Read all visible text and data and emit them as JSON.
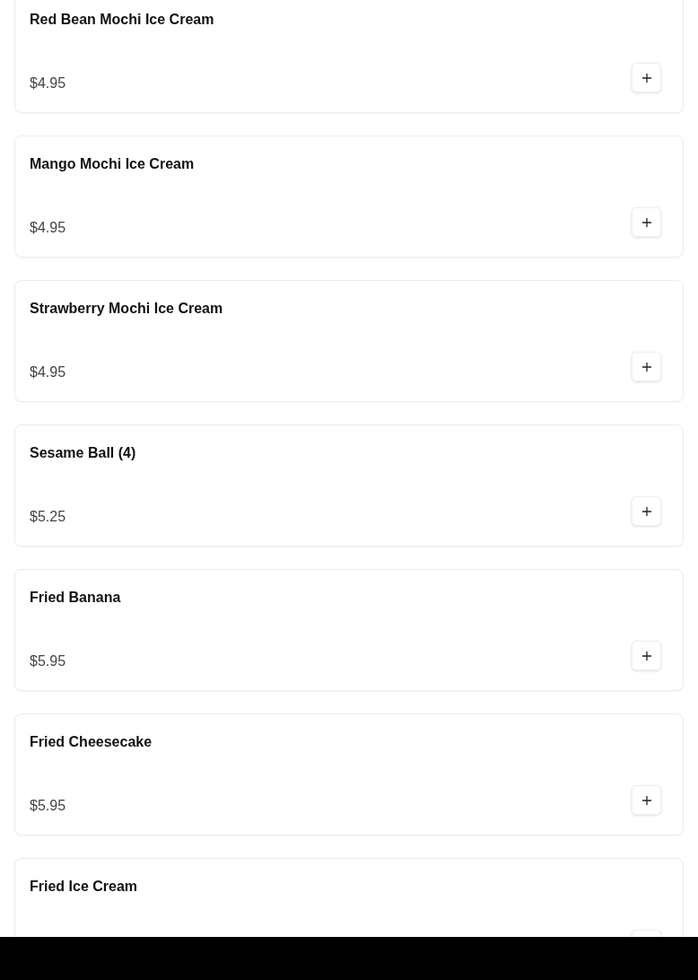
{
  "menu_items": [
    {
      "name": "Red Bean Mochi Ice Cream",
      "price": "$4.95"
    },
    {
      "name": "Mango Mochi Ice Cream",
      "price": "$4.95"
    },
    {
      "name": "Strawberry Mochi Ice Cream",
      "price": "$4.95"
    },
    {
      "name": "Sesame Ball (4)",
      "price": "$5.25"
    },
    {
      "name": "Fried Banana",
      "price": "$5.95"
    },
    {
      "name": "Fried Cheesecake",
      "price": "$5.95"
    },
    {
      "name": "Fried Ice Cream"
    }
  ]
}
